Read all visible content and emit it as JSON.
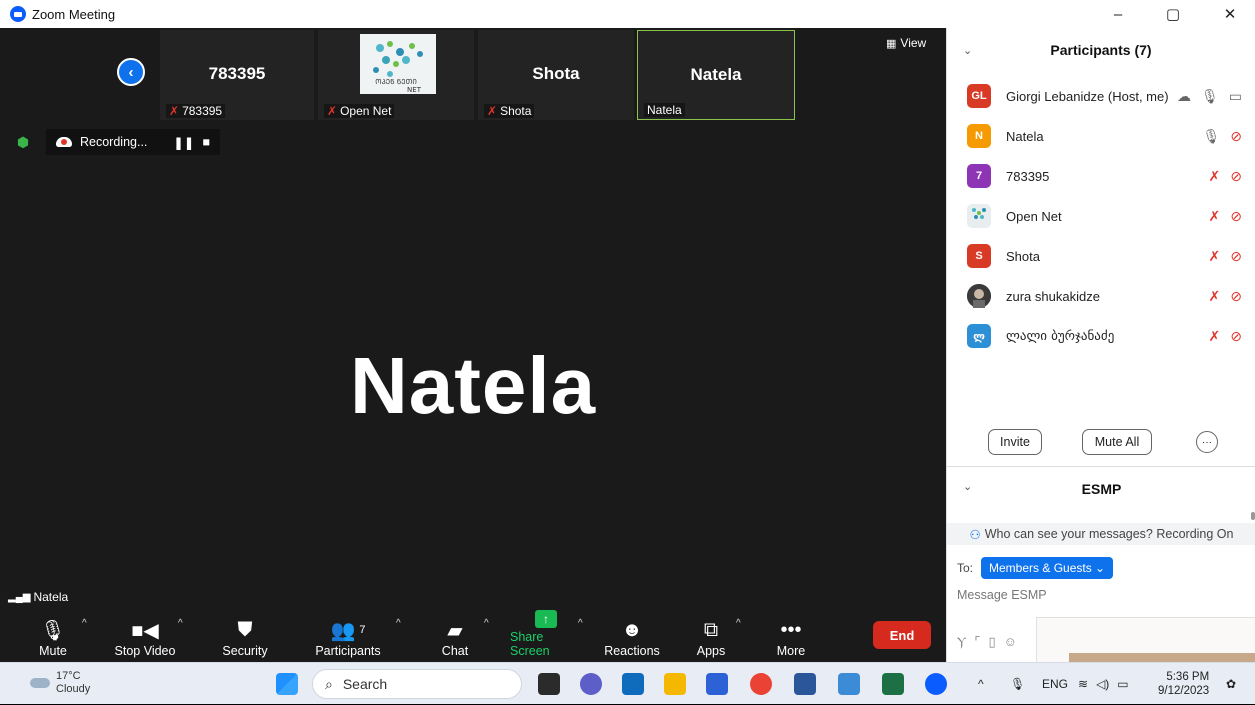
{
  "window": {
    "title": "Zoom Meeting",
    "minimize": "–",
    "restore": "▢",
    "close": "✕"
  },
  "strip": {
    "back_glyph": "‹",
    "tiles": [
      {
        "name": "783395",
        "label": "783395"
      },
      {
        "name": "",
        "label": "Open Net"
      },
      {
        "name": "Shota",
        "label": "Shota"
      },
      {
        "name": "Natela",
        "label": "Natela"
      }
    ],
    "view_label": "View",
    "logo_caption": "ᲝᲞᲔᲜ ᲜᲔᲗᲘ\nNET"
  },
  "recording": {
    "label": "Recording...",
    "pause": "❚❚",
    "stop": "■"
  },
  "main": {
    "speaker_name": "Natela",
    "speaker_label": "Natela"
  },
  "toolbar": {
    "mute": "Mute",
    "stop_video": "Stop Video",
    "security": "Security",
    "participants": "Participants",
    "participants_count": "7",
    "chat": "Chat",
    "share_screen": "Share Screen",
    "reactions": "Reactions",
    "apps": "Apps",
    "more": "More",
    "end": "End"
  },
  "panel": {
    "title": "Participants (7)",
    "participants": [
      {
        "initials": "GL",
        "name": "Giorgi Lebanidze (Host, me)",
        "color": "#d83a26"
      },
      {
        "initials": "N",
        "name": "Natela",
        "color": "#f59a00"
      },
      {
        "initials": "7",
        "name": "783395",
        "color": "#8e35b5"
      },
      {
        "initials": "",
        "name": "Open Net",
        "color": "#e8eef0"
      },
      {
        "initials": "S",
        "name": "Shota",
        "color": "#d83a26"
      },
      {
        "initials": "",
        "name": "zura shukakidze",
        "color": "#555555"
      },
      {
        "initials": "ლ",
        "name": "ლალი ბურჯანაძე",
        "color": "#2d8fd5"
      }
    ],
    "invite": "Invite",
    "mute_all": "Mute All",
    "more": "···"
  },
  "chat": {
    "title": "ESMP",
    "privacy": "Who can see your messages? Recording On",
    "to": "To:",
    "recipient": "Members & Guests",
    "placeholder": "Message ESMP"
  },
  "taskbar": {
    "temp": "17°C",
    "condition": "Cloudy",
    "search": "Search",
    "lang": "ENG",
    "time": "5:36 PM",
    "date": "9/12/2023"
  }
}
